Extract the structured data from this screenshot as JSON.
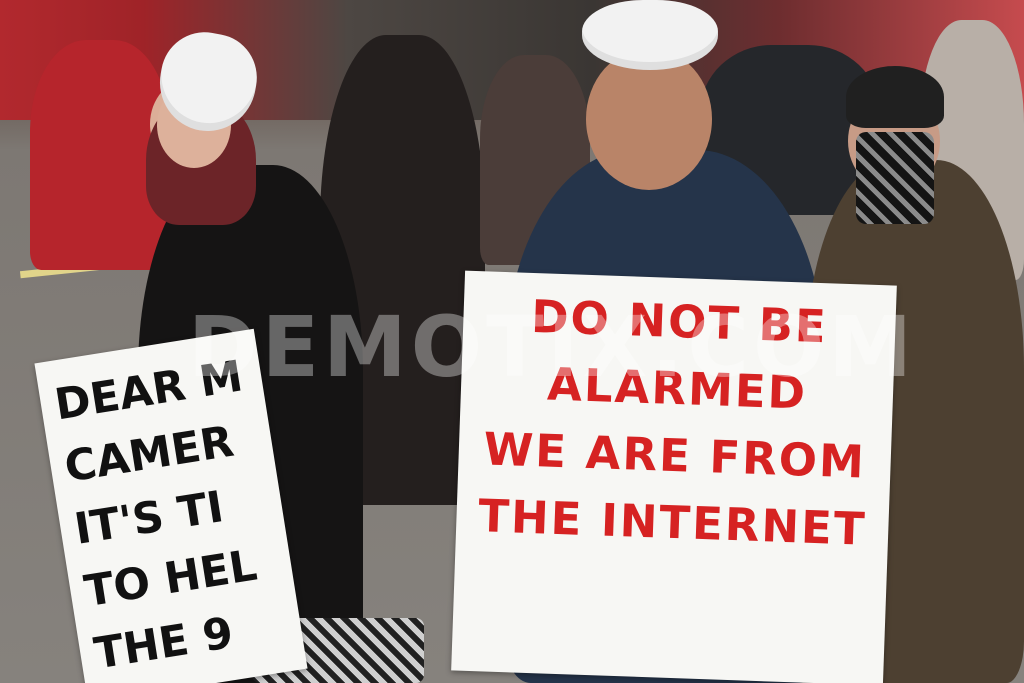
{
  "signs": {
    "main_sign_lines": [
      "DO NOT BE",
      "ALARMED",
      "WE ARE FROM",
      "THE INTERNET"
    ],
    "left_sign_lines": [
      "DEAR M",
      "CAMER",
      "IT'S TI",
      "TO HEL",
      "THE 9"
    ]
  },
  "watermark": {
    "text": "DEMOTIX.COM"
  }
}
